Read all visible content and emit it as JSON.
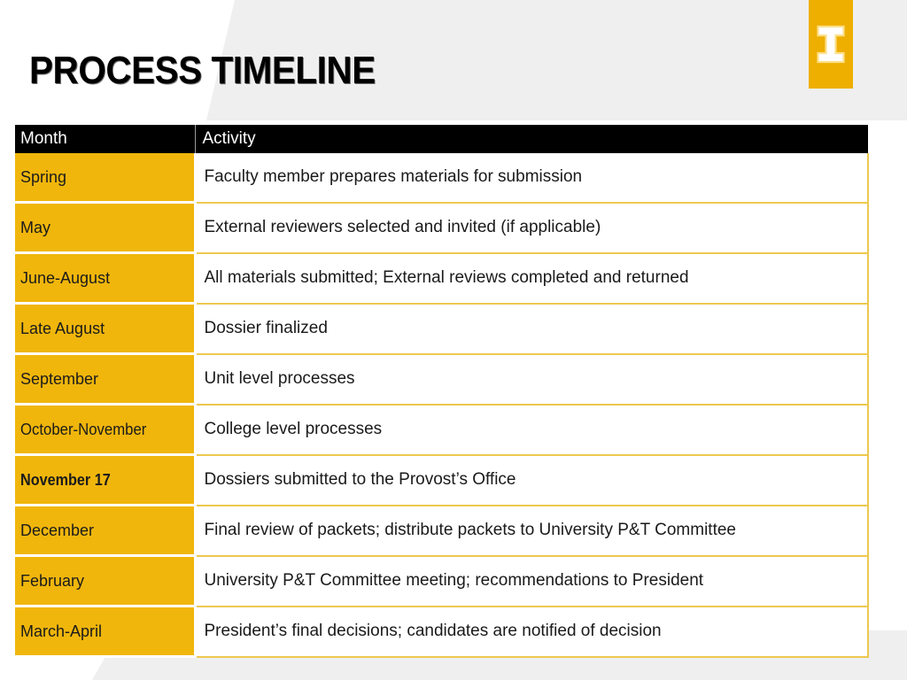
{
  "slide": {
    "title": "PROCESS TIMELINE",
    "colors": {
      "gold": "#F0B60C",
      "logo_gold": "#EEAF00",
      "border_gold": "#EDC94F",
      "header_black": "#000000",
      "background_gray": "#EFEFEF",
      "background_white": "#FFFFFF",
      "text_dark": "#1A1A1A",
      "header_text": "#FFFFFF"
    }
  },
  "logo": {
    "name": "university-block-i-logo",
    "letter": "I"
  },
  "table": {
    "columns": [
      {
        "key": "month",
        "label": "Month"
      },
      {
        "key": "activity",
        "label": "Activity"
      }
    ],
    "rows": [
      {
        "month": "Spring",
        "activity": "Faculty member prepares materials for submission",
        "emphasis": "normal"
      },
      {
        "month": "May",
        "activity": "External reviewers selected and invited (if applicable)",
        "emphasis": "normal"
      },
      {
        "month": "June-August",
        "activity": "All materials submitted; External reviews completed and returned",
        "emphasis": "normal"
      },
      {
        "month": "Late August",
        "activity": "Dossier finalized",
        "emphasis": "normal"
      },
      {
        "month": "September",
        "activity": "Unit level processes",
        "emphasis": "normal"
      },
      {
        "month": "October-November",
        "activity": "College level processes",
        "emphasis": "narrow"
      },
      {
        "month": "November 17",
        "activity": "Dossiers submitted to the Provost’s Office",
        "emphasis": "bold"
      },
      {
        "month": "December",
        "activity": "Final review of packets; distribute packets to University P&T Committee",
        "emphasis": "normal"
      },
      {
        "month": "February",
        "activity": "University P&T Committee meeting; recommendations to President",
        "emphasis": "normal"
      },
      {
        "month": "March-April",
        "activity": "President’s final decisions; candidates are notified of decision",
        "emphasis": "normal"
      }
    ]
  }
}
